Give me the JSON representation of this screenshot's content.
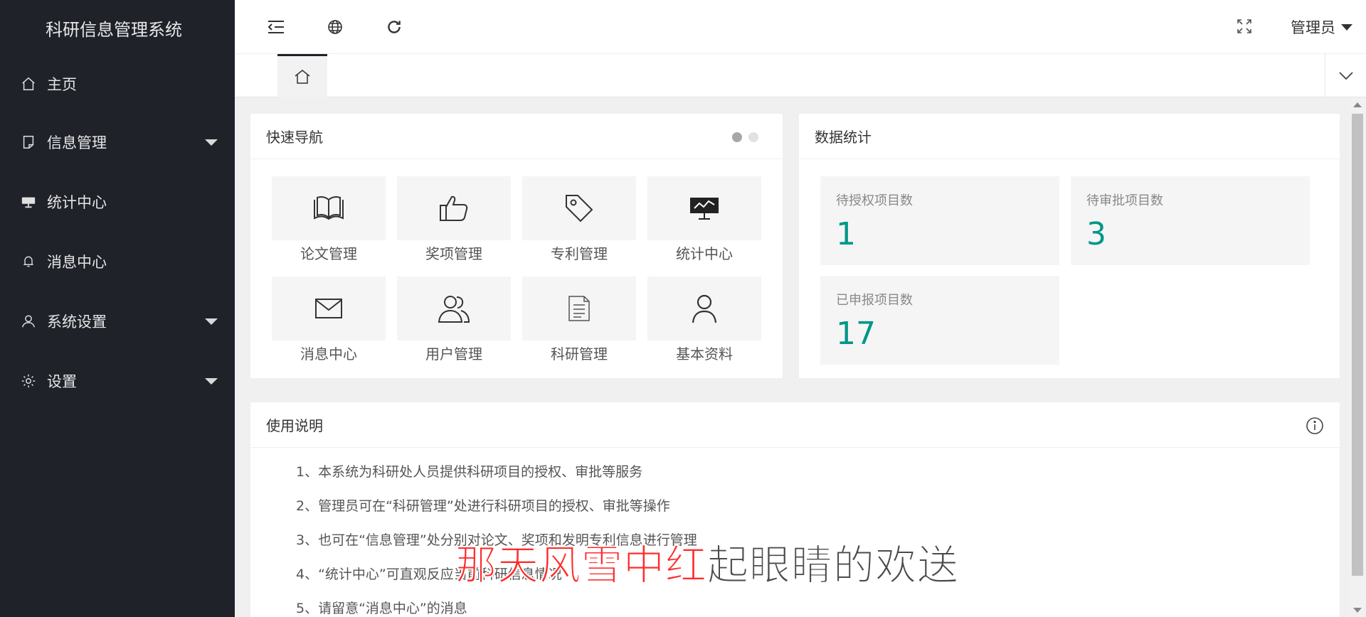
{
  "app": {
    "title": "科研信息管理系统"
  },
  "sidebar": {
    "items": [
      {
        "label": "主页",
        "icon": "home-icon"
      },
      {
        "label": "信息管理",
        "icon": "note-icon"
      },
      {
        "label": "统计中心",
        "icon": "presentation-icon"
      },
      {
        "label": "消息中心",
        "icon": "bell-icon"
      },
      {
        "label": "系统设置",
        "icon": "user-icon"
      },
      {
        "label": "设置",
        "icon": "gear-icon"
      }
    ]
  },
  "header": {
    "user_label": "管理员"
  },
  "quick_nav": {
    "title": "快速导航",
    "tiles": [
      {
        "label": "论文管理",
        "icon": "book-icon"
      },
      {
        "label": "奖项管理",
        "icon": "thumbs-up-icon"
      },
      {
        "label": "专利管理",
        "icon": "tag-icon"
      },
      {
        "label": "统计中心",
        "icon": "chart-board-icon"
      },
      {
        "label": "消息中心",
        "icon": "mail-icon"
      },
      {
        "label": "用户管理",
        "icon": "users-icon"
      },
      {
        "label": "科研管理",
        "icon": "document-icon"
      },
      {
        "label": "基本资料",
        "icon": "person-icon"
      }
    ]
  },
  "stats": {
    "title": "数据统计",
    "items": [
      {
        "label": "待授权项目数",
        "value": "1"
      },
      {
        "label": "待审批项目数",
        "value": "3"
      },
      {
        "label": "已申报项目数",
        "value": "17"
      }
    ],
    "value_color": "#009688"
  },
  "usage": {
    "title": "使用说明",
    "lines": [
      "1、本系统为科研处人员提供科研项目的授权、审批等服务",
      "2、管理员可在“科研管理”处进行科研项目的授权、审批等操作",
      "3、也可在“信息管理”处分别对论文、奖项和发明专利信息进行管理",
      "4、“统计中心”可直观反应当前科研信息情况",
      "5、请留意“消息中心”的消息"
    ]
  },
  "subtitle": {
    "red": "那天风雪中红",
    "white": "起眼睛的欢送"
  }
}
